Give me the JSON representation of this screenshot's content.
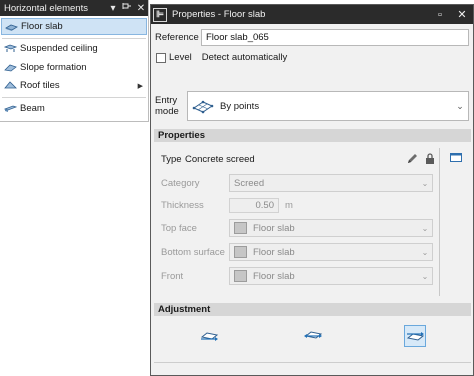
{
  "left_panel": {
    "title": "Horizontal elements",
    "pin_icon": "pin-icon",
    "close_icon": "close-icon",
    "items": [
      {
        "label": "Floor slab",
        "icon": "floor-slab-icon",
        "selected": true
      },
      {
        "label": "Suspended ceiling",
        "icon": "suspended-ceiling-icon"
      },
      {
        "label": "Slope formation",
        "icon": "slope-formation-icon"
      },
      {
        "label": "Roof tiles",
        "icon": "roof-tiles-icon",
        "submenu": true
      },
      {
        "label": "Beam",
        "icon": "beam-icon"
      }
    ]
  },
  "dialog": {
    "title": "Properties - Floor slab",
    "reference_label": "Reference",
    "reference_value": "Floor slab_065",
    "level_label": "Level",
    "level_checked": false,
    "detect_label": "Detect automatically",
    "entry_mode_label_1": "Entry",
    "entry_mode_label_2": "mode",
    "entry_mode_value": "By points",
    "properties_header": "Properties",
    "type_label": "Type",
    "type_value": "Concrete screed",
    "category_label": "Category",
    "category_value": "Screed",
    "thickness_label": "Thickness",
    "thickness_value": "0.50",
    "thickness_unit": "m",
    "top_face_label": "Top face",
    "top_face_value": "Floor slab",
    "bottom_surface_label": "Bottom surface",
    "bottom_surface_value": "Floor slab",
    "front_label": "Front",
    "front_value": "Floor slab",
    "adjustment_header": "Adjustment",
    "adjustment_active_index": 2
  },
  "colors": {
    "titlebar": "#2b2b2b",
    "selection": "#cfe3f5",
    "selection_border": "#88b6e0",
    "accent": "#1f6fb6",
    "section_header": "#d6d6d6"
  }
}
